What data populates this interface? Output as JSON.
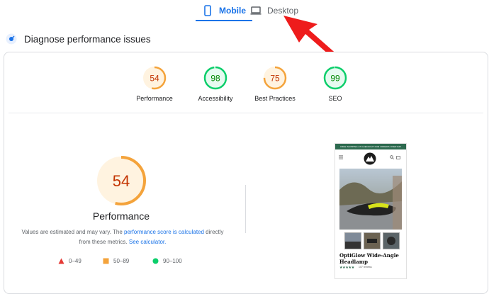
{
  "tabs": [
    {
      "label": "Mobile",
      "active": true
    },
    {
      "label": "Desktop",
      "active": false
    }
  ],
  "section_title": "Diagnose performance issues",
  "scores": [
    {
      "value": "54",
      "label": "Performance",
      "percent": 54,
      "status": "average"
    },
    {
      "value": "98",
      "label": "Accessibility",
      "percent": 98,
      "status": "pass"
    },
    {
      "value": "75",
      "label": "Best Practices",
      "percent": 75,
      "status": "average"
    },
    {
      "value": "99",
      "label": "SEO",
      "percent": 99,
      "status": "pass"
    }
  ],
  "main_score": {
    "value": "54",
    "label": "Performance",
    "percent": 54
  },
  "description": {
    "prefix": "Values are estimated and may vary. The ",
    "link1": "performance score is calculated",
    "middle": " directly from these metrics. ",
    "link2": "See calculator."
  },
  "legend": [
    {
      "range": "0–49",
      "shape": "triangle",
      "color": "#e53935"
    },
    {
      "range": "50–89",
      "shape": "square",
      "color": "#f4a33b"
    },
    {
      "range": "90–100",
      "shape": "circle",
      "color": "#0cce6b"
    }
  ],
  "colors": {
    "accent": "#1a73e8",
    "pass": "#0cce6b",
    "pass_text": "#008800",
    "average": "#f4a33b",
    "average_text": "#c33300",
    "average_bg": "#fff3e0",
    "pass_bg": "#e6faf0",
    "fail": "#e53935",
    "arrow": "#ee1c1c"
  },
  "phone": {
    "banner": "FREE SHIPPING AT CHECKOUT FOR ORDERS OVER $45",
    "product_title": "OptiGlow Wide-Angle Headlamp",
    "stars": "★★★★★",
    "reviews": "107 reviews"
  }
}
